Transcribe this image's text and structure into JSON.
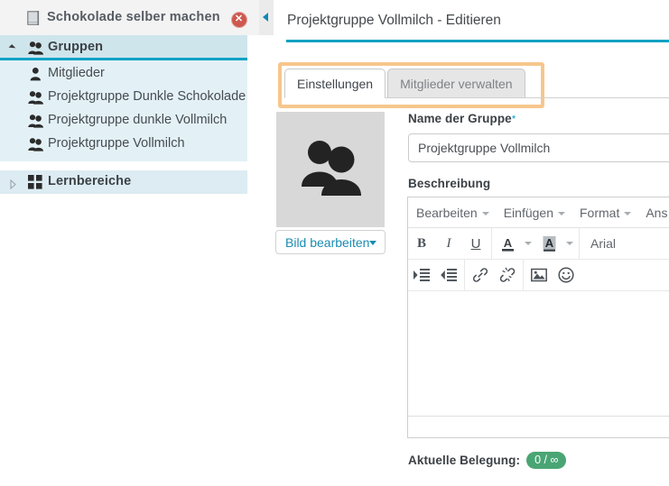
{
  "sidebar": {
    "title": "Schokolade selber machen",
    "book_icon": "book-icon",
    "close_icon": "close-icon",
    "groups": [
      {
        "label": "Gruppen",
        "icon": "people-icon",
        "expanded": true,
        "items": [
          {
            "label": "Mitglieder",
            "icon": "person-icon"
          },
          {
            "label": "Projektgruppe Dunkle Schokolade",
            "icon": "people-icon"
          },
          {
            "label": "Projektgruppe dunkle Vollmilch",
            "icon": "people-icon"
          },
          {
            "label": "Projektgruppe Vollmilch",
            "icon": "people-icon"
          }
        ]
      },
      {
        "label": "Lernbereiche",
        "icon": "grid-icon",
        "expanded": false,
        "items": []
      }
    ]
  },
  "splitter": {
    "collapse_icon": "collapse-left-icon"
  },
  "panel": {
    "title": "Projektgruppe Vollmilch - Editieren",
    "tabs": [
      {
        "label": "Einstellungen",
        "active": true
      },
      {
        "label": "Mitglieder verwalten",
        "active": false
      }
    ],
    "highlight_color": "#f7c68c",
    "accent_color": "#12a1c4"
  },
  "form": {
    "avatar_icon": "people-avatar-icon",
    "image_edit_label": "Bild bearbeiten",
    "name_label": "Name der Gruppe",
    "name_required_marker": "*",
    "name_value": "Projektgruppe Vollmilch",
    "name_placeholder": "Name der Gruppe",
    "description_label": "Beschreibung",
    "occupancy_label": "Aktuelle Belegung:",
    "occupancy_value": "0 / ∞",
    "occupancy_color": "#4aa574"
  },
  "editor": {
    "menus": [
      "Bearbeiten",
      "Einfügen",
      "Format",
      "Ans"
    ],
    "toolbar_row1": [
      {
        "name": "bold-icon",
        "glyph": "B"
      },
      {
        "name": "italic-icon",
        "glyph": "I"
      },
      {
        "name": "underline-icon",
        "glyph": "U"
      },
      {
        "name": "text-color-icon",
        "glyph": "A"
      },
      {
        "name": "background-color-icon",
        "glyph": "A"
      }
    ],
    "font_name": "Arial",
    "toolbar_row2": [
      {
        "name": "indent-icon"
      },
      {
        "name": "outdent-icon"
      },
      {
        "name": "link-icon"
      },
      {
        "name": "unlink-icon"
      },
      {
        "name": "image-icon"
      },
      {
        "name": "emoticon-icon"
      }
    ],
    "content": ""
  }
}
